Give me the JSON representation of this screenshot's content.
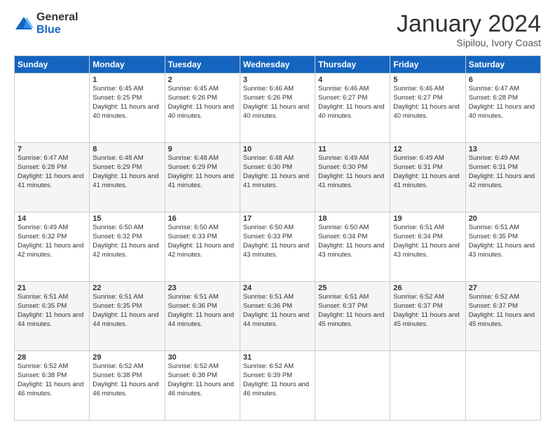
{
  "logo": {
    "general": "General",
    "blue": "Blue"
  },
  "title": {
    "month": "January 2024",
    "location": "Sipilou, Ivory Coast"
  },
  "header": {
    "days": [
      "Sunday",
      "Monday",
      "Tuesday",
      "Wednesday",
      "Thursday",
      "Friday",
      "Saturday"
    ]
  },
  "weeks": [
    [
      {
        "day": "",
        "sunrise": "",
        "sunset": "",
        "daylight": ""
      },
      {
        "day": "1",
        "sunrise": "Sunrise: 6:45 AM",
        "sunset": "Sunset: 6:25 PM",
        "daylight": "Daylight: 11 hours and 40 minutes."
      },
      {
        "day": "2",
        "sunrise": "Sunrise: 6:45 AM",
        "sunset": "Sunset: 6:26 PM",
        "daylight": "Daylight: 11 hours and 40 minutes."
      },
      {
        "day": "3",
        "sunrise": "Sunrise: 6:46 AM",
        "sunset": "Sunset: 6:26 PM",
        "daylight": "Daylight: 11 hours and 40 minutes."
      },
      {
        "day": "4",
        "sunrise": "Sunrise: 6:46 AM",
        "sunset": "Sunset: 6:27 PM",
        "daylight": "Daylight: 11 hours and 40 minutes."
      },
      {
        "day": "5",
        "sunrise": "Sunrise: 6:46 AM",
        "sunset": "Sunset: 6:27 PM",
        "daylight": "Daylight: 11 hours and 40 minutes."
      },
      {
        "day": "6",
        "sunrise": "Sunrise: 6:47 AM",
        "sunset": "Sunset: 6:28 PM",
        "daylight": "Daylight: 11 hours and 40 minutes."
      }
    ],
    [
      {
        "day": "7",
        "sunrise": "Sunrise: 6:47 AM",
        "sunset": "Sunset: 6:28 PM",
        "daylight": "Daylight: 11 hours and 41 minutes."
      },
      {
        "day": "8",
        "sunrise": "Sunrise: 6:48 AM",
        "sunset": "Sunset: 6:29 PM",
        "daylight": "Daylight: 11 hours and 41 minutes."
      },
      {
        "day": "9",
        "sunrise": "Sunrise: 6:48 AM",
        "sunset": "Sunset: 6:29 PM",
        "daylight": "Daylight: 11 hours and 41 minutes."
      },
      {
        "day": "10",
        "sunrise": "Sunrise: 6:48 AM",
        "sunset": "Sunset: 6:30 PM",
        "daylight": "Daylight: 11 hours and 41 minutes."
      },
      {
        "day": "11",
        "sunrise": "Sunrise: 6:49 AM",
        "sunset": "Sunset: 6:30 PM",
        "daylight": "Daylight: 11 hours and 41 minutes."
      },
      {
        "day": "12",
        "sunrise": "Sunrise: 6:49 AM",
        "sunset": "Sunset: 6:31 PM",
        "daylight": "Daylight: 11 hours and 41 minutes."
      },
      {
        "day": "13",
        "sunrise": "Sunrise: 6:49 AM",
        "sunset": "Sunset: 6:31 PM",
        "daylight": "Daylight: 11 hours and 42 minutes."
      }
    ],
    [
      {
        "day": "14",
        "sunrise": "Sunrise: 6:49 AM",
        "sunset": "Sunset: 6:32 PM",
        "daylight": "Daylight: 11 hours and 42 minutes."
      },
      {
        "day": "15",
        "sunrise": "Sunrise: 6:50 AM",
        "sunset": "Sunset: 6:32 PM",
        "daylight": "Daylight: 11 hours and 42 minutes."
      },
      {
        "day": "16",
        "sunrise": "Sunrise: 6:50 AM",
        "sunset": "Sunset: 6:33 PM",
        "daylight": "Daylight: 11 hours and 42 minutes."
      },
      {
        "day": "17",
        "sunrise": "Sunrise: 6:50 AM",
        "sunset": "Sunset: 6:33 PM",
        "daylight": "Daylight: 11 hours and 43 minutes."
      },
      {
        "day": "18",
        "sunrise": "Sunrise: 6:50 AM",
        "sunset": "Sunset: 6:34 PM",
        "daylight": "Daylight: 11 hours and 43 minutes."
      },
      {
        "day": "19",
        "sunrise": "Sunrise: 6:51 AM",
        "sunset": "Sunset: 6:34 PM",
        "daylight": "Daylight: 11 hours and 43 minutes."
      },
      {
        "day": "20",
        "sunrise": "Sunrise: 6:51 AM",
        "sunset": "Sunset: 6:35 PM",
        "daylight": "Daylight: 11 hours and 43 minutes."
      }
    ],
    [
      {
        "day": "21",
        "sunrise": "Sunrise: 6:51 AM",
        "sunset": "Sunset: 6:35 PM",
        "daylight": "Daylight: 11 hours and 44 minutes."
      },
      {
        "day": "22",
        "sunrise": "Sunrise: 6:51 AM",
        "sunset": "Sunset: 6:35 PM",
        "daylight": "Daylight: 11 hours and 44 minutes."
      },
      {
        "day": "23",
        "sunrise": "Sunrise: 6:51 AM",
        "sunset": "Sunset: 6:36 PM",
        "daylight": "Daylight: 11 hours and 44 minutes."
      },
      {
        "day": "24",
        "sunrise": "Sunrise: 6:51 AM",
        "sunset": "Sunset: 6:36 PM",
        "daylight": "Daylight: 11 hours and 44 minutes."
      },
      {
        "day": "25",
        "sunrise": "Sunrise: 6:51 AM",
        "sunset": "Sunset: 6:37 PM",
        "daylight": "Daylight: 11 hours and 45 minutes."
      },
      {
        "day": "26",
        "sunrise": "Sunrise: 6:52 AM",
        "sunset": "Sunset: 6:37 PM",
        "daylight": "Daylight: 11 hours and 45 minutes."
      },
      {
        "day": "27",
        "sunrise": "Sunrise: 6:52 AM",
        "sunset": "Sunset: 6:37 PM",
        "daylight": "Daylight: 11 hours and 45 minutes."
      }
    ],
    [
      {
        "day": "28",
        "sunrise": "Sunrise: 6:52 AM",
        "sunset": "Sunset: 6:38 PM",
        "daylight": "Daylight: 11 hours and 46 minutes."
      },
      {
        "day": "29",
        "sunrise": "Sunrise: 6:52 AM",
        "sunset": "Sunset: 6:38 PM",
        "daylight": "Daylight: 11 hours and 46 minutes."
      },
      {
        "day": "30",
        "sunrise": "Sunrise: 6:52 AM",
        "sunset": "Sunset: 6:38 PM",
        "daylight": "Daylight: 11 hours and 46 minutes."
      },
      {
        "day": "31",
        "sunrise": "Sunrise: 6:52 AM",
        "sunset": "Sunset: 6:39 PM",
        "daylight": "Daylight: 11 hours and 46 minutes."
      },
      {
        "day": "",
        "sunrise": "",
        "sunset": "",
        "daylight": ""
      },
      {
        "day": "",
        "sunrise": "",
        "sunset": "",
        "daylight": ""
      },
      {
        "day": "",
        "sunrise": "",
        "sunset": "",
        "daylight": ""
      }
    ]
  ]
}
